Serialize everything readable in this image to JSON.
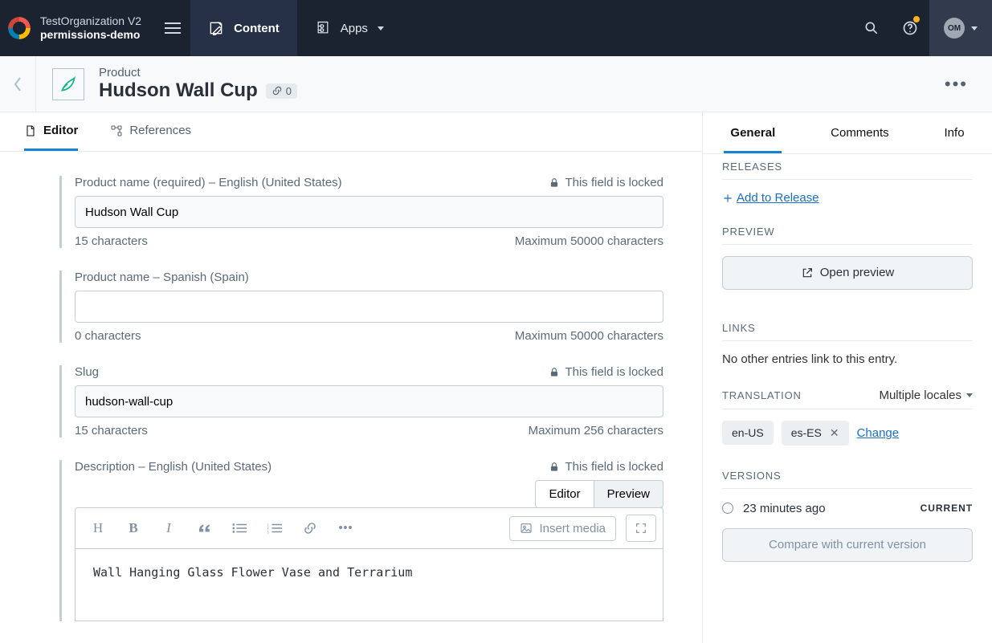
{
  "brand": {
    "org": "TestOrganization V2",
    "space": "permissions-demo"
  },
  "nav": {
    "content": "Content",
    "apps": "Apps"
  },
  "user": {
    "initials": "OM"
  },
  "header": {
    "type": "Product",
    "name": "Hudson Wall Cup",
    "link_count": "0"
  },
  "tabs": {
    "editor": "Editor",
    "references": "References"
  },
  "lock_text": "This field is locked",
  "fields": {
    "name_en": {
      "label": "Product name (required) – English (United States)",
      "value": "Hudson Wall Cup",
      "chars": "15 characters",
      "max": "Maximum 50000 characters"
    },
    "name_es": {
      "label": "Product name – Spanish (Spain)",
      "value": "",
      "chars": "0 characters",
      "max": "Maximum 50000 characters"
    },
    "slug": {
      "label": "Slug",
      "value": "hudson-wall-cup",
      "chars": "15 characters",
      "max": "Maximum 256 characters"
    },
    "desc_en": {
      "label": "Description – English (United States)",
      "editor_btn": "Editor",
      "preview_btn": "Preview",
      "insert_media": "Insert media",
      "body": "Wall Hanging Glass Flower Vase and Terrarium"
    }
  },
  "sidebar": {
    "tabs": {
      "general": "General",
      "comments": "Comments",
      "info": "Info"
    },
    "releases": {
      "title": "RELEASES",
      "add": "Add to Release"
    },
    "preview": {
      "title": "PREVIEW",
      "open": "Open preview"
    },
    "links": {
      "title": "LINKS",
      "empty": "No other entries link to this entry."
    },
    "translation": {
      "title": "TRANSLATION",
      "mode": "Multiple locales",
      "en": "en-US",
      "es": "es-ES",
      "change": "Change"
    },
    "versions": {
      "title": "VERSIONS",
      "ago": "23 minutes ago",
      "current": "CURRENT",
      "compare": "Compare with current version"
    }
  }
}
